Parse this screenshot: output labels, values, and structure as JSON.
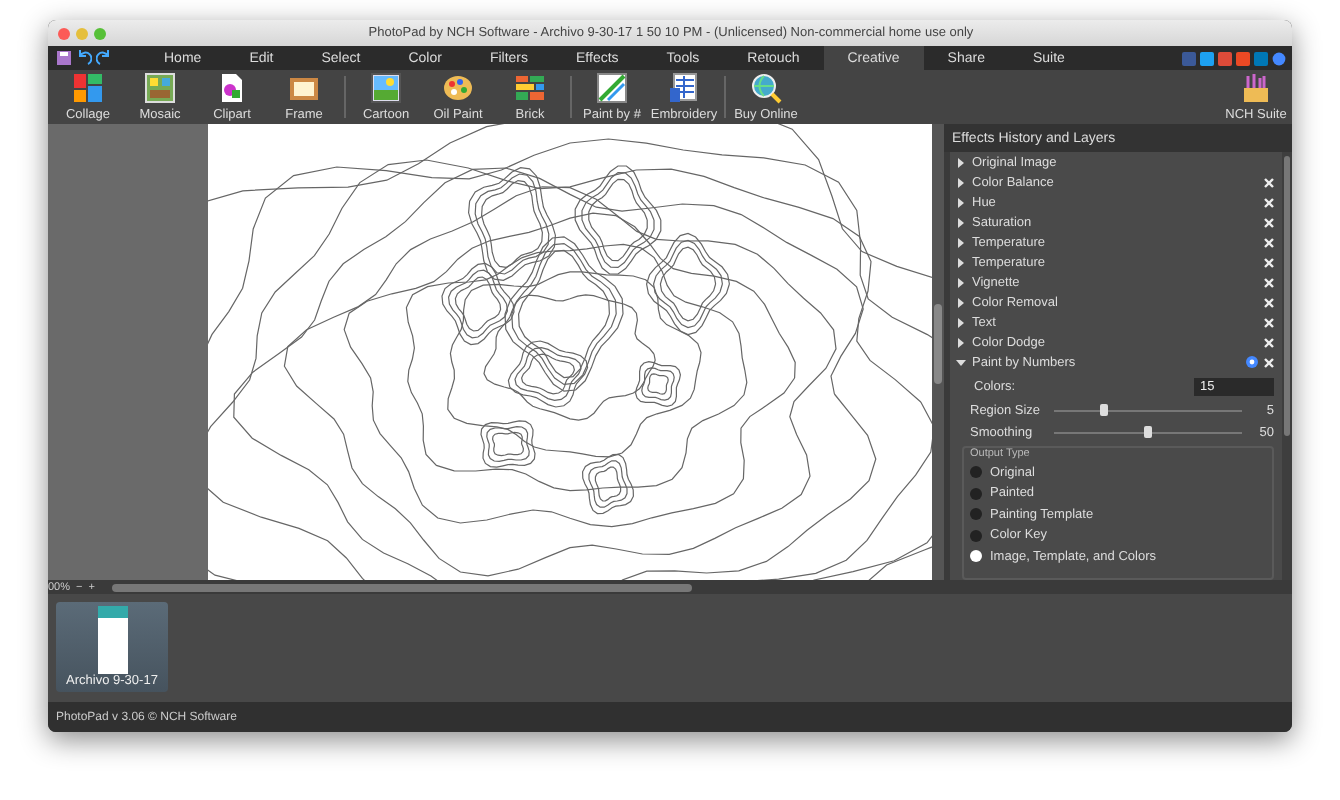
{
  "window": {
    "title": "PhotoPad by NCH Software - Archivo 9-30-17 1 50 10 PM - (Unlicensed) Non-commercial home use only"
  },
  "tabs": [
    {
      "label": "Home",
      "selected": false
    },
    {
      "label": "Edit",
      "selected": false
    },
    {
      "label": "Select",
      "selected": false
    },
    {
      "label": "Color",
      "selected": false
    },
    {
      "label": "Filters",
      "selected": false
    },
    {
      "label": "Effects",
      "selected": false
    },
    {
      "label": "Tools",
      "selected": false
    },
    {
      "label": "Retouch",
      "selected": false
    },
    {
      "label": "Creative",
      "selected": true
    },
    {
      "label": "Share",
      "selected": false
    },
    {
      "label": "Suite",
      "selected": false
    }
  ],
  "toolbar": [
    {
      "label": "Collage",
      "kind": "collage"
    },
    {
      "label": "Mosaic",
      "kind": "mosaic"
    },
    {
      "label": "Clipart",
      "kind": "clipart"
    },
    {
      "label": "Frame",
      "kind": "frame",
      "sep_after": true
    },
    {
      "label": "Cartoon",
      "kind": "cartoon"
    },
    {
      "label": "Oil Paint",
      "kind": "palette"
    },
    {
      "label": "Brick",
      "kind": "brick",
      "sep_after": true
    },
    {
      "label": "Paint by #",
      "kind": "paintnum"
    },
    {
      "label": "Embroidery",
      "kind": "embroidery",
      "sep_after": true
    },
    {
      "label": "Buy Online",
      "kind": "buy"
    }
  ],
  "suite_button": {
    "label": "NCH Suite"
  },
  "zoom": {
    "value": "00%",
    "out_label": "−",
    "in_label": "+"
  },
  "panel": {
    "title": "Effects History and Layers",
    "layers": [
      {
        "name": "Original Image",
        "expanded": false,
        "removable": false,
        "help": false
      },
      {
        "name": "Color Balance",
        "expanded": false,
        "removable": true,
        "help": false
      },
      {
        "name": "Hue",
        "expanded": false,
        "removable": true,
        "help": false
      },
      {
        "name": "Saturation",
        "expanded": false,
        "removable": true,
        "help": false
      },
      {
        "name": "Temperature",
        "expanded": false,
        "removable": true,
        "help": false
      },
      {
        "name": "Temperature",
        "expanded": false,
        "removable": true,
        "help": false
      },
      {
        "name": "Vignette",
        "expanded": false,
        "removable": true,
        "help": false
      },
      {
        "name": "Color Removal",
        "expanded": false,
        "removable": true,
        "help": false
      },
      {
        "name": "Text",
        "expanded": false,
        "removable": true,
        "help": false
      },
      {
        "name": "Color Dodge",
        "expanded": false,
        "removable": true,
        "help": false
      },
      {
        "name": "Paint by Numbers",
        "expanded": true,
        "removable": true,
        "help": true
      }
    ],
    "colors": {
      "label": "Colors:",
      "value": "15"
    },
    "sliders": [
      {
        "label": "Region Size",
        "level": 0.27,
        "reading": "5"
      },
      {
        "label": "Smoothing",
        "level": 0.5,
        "reading": "50"
      }
    ],
    "output_type": {
      "title": "Output Type",
      "options": [
        {
          "label": "Original",
          "selected": false
        },
        {
          "label": "Painted",
          "selected": false
        },
        {
          "label": "Painting Template",
          "selected": false
        },
        {
          "label": "Color Key",
          "selected": false
        },
        {
          "label": "Image, Template, and Colors",
          "selected": true
        }
      ]
    }
  },
  "filmstrip": [
    {
      "label": "Archivo 9-30-17",
      "selected": true
    }
  ],
  "status_bar": "PhotoPad v 3.06 © NCH Software"
}
